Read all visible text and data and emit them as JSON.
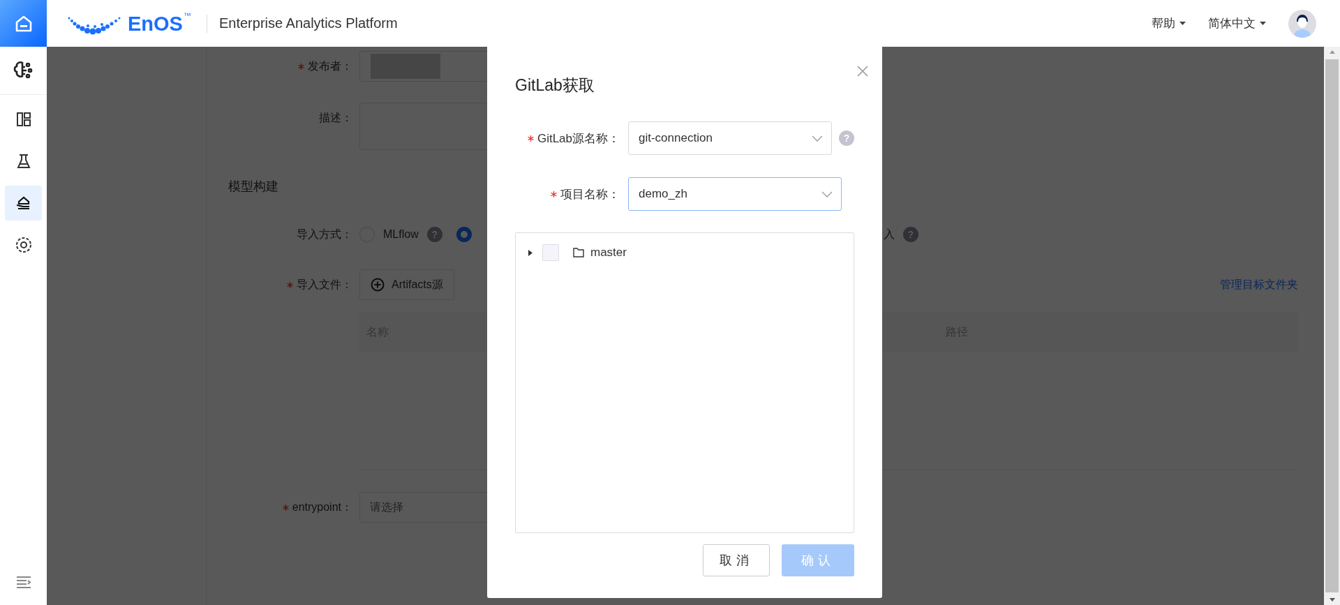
{
  "header": {
    "logo_text": "EnOS",
    "logo_mark": "™",
    "title": "Enterprise Analytics Platform",
    "menus": [
      {
        "label": "帮助"
      },
      {
        "label": "简体中文"
      }
    ]
  },
  "sidebar": {
    "items": [
      {
        "kind": "dashboard",
        "selected": false
      },
      {
        "kind": "flask",
        "selected": false
      },
      {
        "kind": "model",
        "selected": true
      },
      {
        "kind": "settings",
        "selected": false
      }
    ]
  },
  "form": {
    "fields": [
      {
        "kind": "masked",
        "label": "发布者：",
        "required": true
      },
      {
        "kind": "textarea",
        "label": "描述：",
        "required": false
      }
    ],
    "section_title": "模型构建",
    "import_method": {
      "label": "导入方式：",
      "options": [
        {
          "label": "MLflow",
          "help": "?",
          "selected": false
        },
        {
          "selected": true
        }
      ],
      "trailing_text": "入",
      "trailing_help": "?"
    },
    "import_file": {
      "label": "导入文件：",
      "required": true,
      "button": "Artifacts源",
      "link": "管理目标文件夹",
      "columns": [
        "名称",
        "路径"
      ]
    },
    "entrypoint": {
      "label": "entrypoint：",
      "required": true,
      "placeholder": "请选择"
    }
  },
  "modal": {
    "title": "GitLab获取",
    "fields": [
      {
        "label": "GitLab源名称：",
        "required": true,
        "value": "git-connection",
        "focused": false,
        "help": "?"
      },
      {
        "label": "项目名称：",
        "required": true,
        "value": "demo_zh",
        "focused": true
      }
    ],
    "tree": [
      {
        "label": "master",
        "expanded": false,
        "checked": false
      }
    ],
    "buttons": [
      {
        "kind": "default",
        "label": "取消",
        "disabled": false
      },
      {
        "kind": "primary",
        "label": "确认",
        "disabled": true
      }
    ]
  }
}
